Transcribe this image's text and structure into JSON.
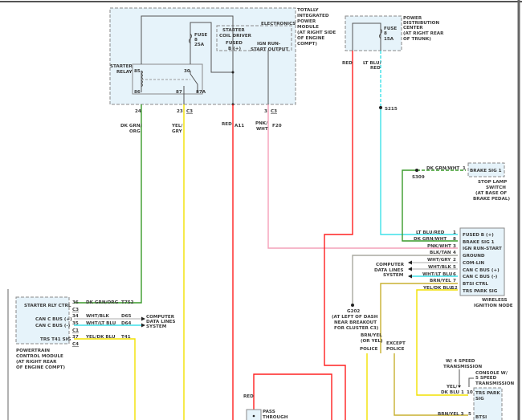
{
  "wire_colors": {
    "red": "#ff2020",
    "green": "#3a9a2a",
    "yellow": "#f2e000",
    "pink": "#f4a0b8",
    "cyan": "#3fe0e8",
    "gray": "#a8a8a0",
    "olive": "#c8b030",
    "lightgray": "#c8c8c8"
  },
  "tipm": {
    "title": [
      "TOTALLY",
      "INTEGRATED",
      "POWER",
      "MODULE",
      "(AT RIGHT SIDE",
      "OF ENGINE",
      "COMPT)"
    ],
    "electronics": "ELECTRONICS",
    "coil_driver": [
      "STARTER",
      "COIL DRIVER"
    ],
    "fused": [
      "FUSED",
      "B (+)"
    ],
    "ign_output": [
      "IGN RUN-",
      "START OUTPUT"
    ],
    "fuse": [
      "FUSE",
      "8",
      "25A"
    ],
    "relay": [
      "STARTER",
      "RELAY"
    ],
    "relay_pins": [
      "85",
      "86",
      "30",
      "87",
      "87A"
    ],
    "pins": [
      "24",
      "23",
      "C3",
      "3",
      "C3"
    ],
    "wires": {
      "w1": [
        "DK GRN/",
        "ORG"
      ],
      "w2": [
        "YEL/",
        "GRY"
      ],
      "w3": "RED",
      "w3_circuit": "A11",
      "w4": [
        "PNK/",
        "WHT"
      ],
      "w4_circuit": "F20"
    }
  },
  "pdc": {
    "title": [
      "POWER",
      "DISTRIBUTION",
      "CENTER",
      "(AT RIGHT REAR",
      "OF TRUNK)"
    ],
    "fuse": [
      "FUSE",
      "8",
      "15A"
    ],
    "wire_red": "RED",
    "wire_blu": [
      "LT BLU/",
      "RED"
    ],
    "splice": "S215"
  },
  "stop_lamp": {
    "wire": "DK GRN/WHT",
    "pin": "1",
    "splice": "S309",
    "pin_label": "BRAKE SIG 1",
    "title": [
      "STOP LAMP",
      "SWITCH",
      "(AT BASE OF",
      "BRAKE PEDAL)"
    ]
  },
  "win": {
    "title": [
      "WIRELESS",
      "IGNITION NODE"
    ],
    "pins": [
      {
        "label": "FUSED B (+)",
        "pin": "1",
        "wire": "LT BLU/RED"
      },
      {
        "label": "BRAKE SIG 1",
        "pin": "8",
        "wire": "DK GRN/WHT"
      },
      {
        "label": "IGN RUN-START",
        "pin": "3",
        "wire": "PNK/WHT"
      },
      {
        "label": "GROUND",
        "pin": "4",
        "wire": "BLK/TAN"
      },
      {
        "label": "COM-LIN",
        "pin": "2",
        "wire": "WHT/GRY"
      },
      {
        "label": "CAN C BUS (+)",
        "pin": "5",
        "wire": "WHT/BLK"
      },
      {
        "label": "CAN C BUS (-)",
        "pin": "6",
        "wire": "WHT/LT BLU"
      },
      {
        "label": "BTSI CTRL",
        "pin": "7",
        "wire": "BRN/YEL"
      },
      {
        "label": "TRS PARK SIG",
        "pin": "12",
        "wire": "YEL/DK BLU"
      }
    ],
    "data_lines": [
      "COMPUTER",
      "DATA LINES",
      "SYSTEM"
    ]
  },
  "ground": {
    "id": "G202",
    "desc": [
      "(AT LEFT OF DASH",
      "NEAR BREAKOUT",
      "FOR CLUSTER C3)"
    ]
  },
  "btsi": {
    "wire": [
      "BRN/YEL",
      "(OR YEL)"
    ],
    "police": "POLICE",
    "except": [
      "EXCEPT",
      "POLICE"
    ]
  },
  "shifter": {
    "four_speed": [
      "W/ 4 SPEED",
      "TRANSMISSION"
    ],
    "five_speed": [
      "CONSOLE W/",
      "5 SPEED",
      "TRANSMISSION"
    ],
    "trs_wire": [
      "YEL/",
      "DK BLU 1"
    ],
    "trs_pin": "10",
    "trs_label": [
      "TRS PARK",
      "SIG"
    ],
    "btsi_wire": "BRN/YEL 3",
    "btsi_pin": "5",
    "btsi_label": "BTSI"
  },
  "pcm": {
    "title": [
      "POWERTRAIN",
      "CONTROL MODULE",
      "(AT RIGHT REAR",
      "OF ENGINE COMPT)"
    ],
    "pins": [
      {
        "label": "STARTER RLY CTRL",
        "pin": "36",
        "conn": "C3",
        "wire": "DK GRN/ORG",
        "circuit": "T752"
      },
      {
        "label": "CAN C BUS (+)",
        "pin": "34",
        "wire": "WHT/BLK",
        "circuit": "D65"
      },
      {
        "label": "CAN C BUS (-)",
        "pin": "35",
        "conn": "C1",
        "wire": "WHT/LT BLU",
        "circuit": "D64"
      },
      {
        "label": "TRS T41 SIG",
        "pin": "37",
        "conn": "C4",
        "wire": "YEL/DK BLU",
        "circuit": "T41"
      }
    ],
    "data_lines": [
      "COMPUTER",
      "DATA LINES",
      "SYSTEM"
    ]
  },
  "lower": {
    "wire": "RED",
    "pass_through": [
      "PASS",
      "THROUGH"
    ]
  }
}
